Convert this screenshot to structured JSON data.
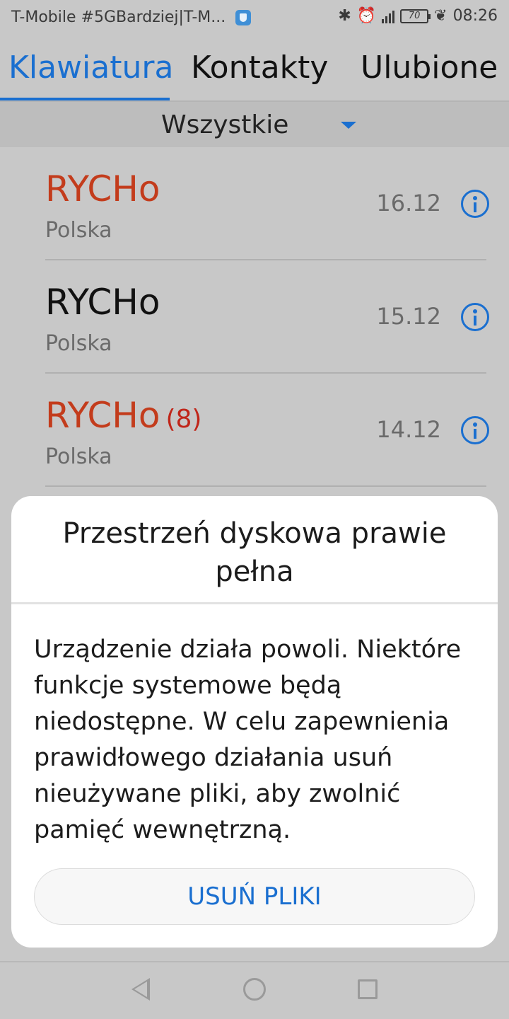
{
  "status_bar": {
    "carrier": "T-Mobile #5GBardziej|T-M...",
    "battery": "70",
    "time": "08:26",
    "icons": [
      "shield-icon",
      "bluetooth-icon",
      "alarm-icon",
      "signal-icon",
      "battery-icon",
      "leaf-icon"
    ]
  },
  "tabs": [
    {
      "label": "Klawiatura",
      "active": true
    },
    {
      "label": "Kontakty",
      "active": false
    },
    {
      "label": "Ulubione",
      "active": false
    }
  ],
  "filter": {
    "label": "Wszystkie"
  },
  "calls": [
    {
      "name": "RYCHo",
      "count": "",
      "missed": true,
      "location": "Polska",
      "date": "16.12"
    },
    {
      "name": "RYCHo",
      "count": "",
      "missed": false,
      "location": "Polska",
      "date": "15.12"
    },
    {
      "name": "RYCHo",
      "count": "(8)",
      "missed": true,
      "location": "Polska",
      "date": "14.12"
    }
  ],
  "dialog": {
    "title": "Przestrzeń dyskowa prawie pełna",
    "body": "Urządzenie działa powoli. Niektóre funkcje systemowe będą niedostępne. W celu zapewnienia prawidłowego działania usuń nieużywane pliki, aby zwolnić pamięć wewnętrzną.",
    "button": "USUŃ PLIKI"
  },
  "colors": {
    "accent": "#1a6fd0",
    "missed": "#c33c1c",
    "scrim_bg": "#c8c8c8"
  }
}
